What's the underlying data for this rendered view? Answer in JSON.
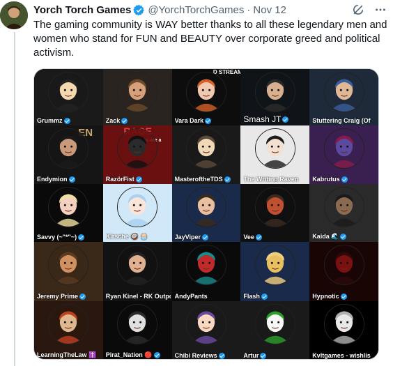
{
  "tweet": {
    "display_name": "Yorch Torch Games",
    "handle": "@YorchTorchGames",
    "separator": "·",
    "time": "Nov 12",
    "text": "The gaming community is WAY better thanks to all these legendary men and women who stand for FUN and BEAUTY over corporate greed and political activism.",
    "icons": {
      "avatar": "user-avatar",
      "verified": "verified-badge-icon",
      "grok": "grok-icon",
      "more": "more-icon"
    }
  },
  "media": {
    "background_texts": [
      "D STREAME",
      "EN",
      "RAGE",
      "ames are a"
    ],
    "cells": [
      {
        "name": "Grummz",
        "verified": true,
        "bg": "#1a1a1a",
        "face": "#f5d7b0",
        "hair": "#222"
      },
      {
        "name": "Zack",
        "verified": true,
        "bg": "#2a2420",
        "face": "#d6a07a",
        "hair": "#6b4a2a"
      },
      {
        "name": "Vara Dark",
        "verified": true,
        "bg": "#0d0d0d",
        "face": "#f0c9b0",
        "hair": "#d4622a"
      },
      {
        "name": "Smash JT",
        "verified": true,
        "bg": "#101418",
        "face": "#d8b090",
        "hair": "#2a2a2a",
        "big": true
      },
      {
        "name": "Stuttering Craig (Of",
        "verified": false,
        "bg": "#1e2a3a",
        "face": "#e0b896",
        "hair": "#3a5e9a"
      },
      {
        "name": "Endymion",
        "verified": true,
        "bg": "#151515",
        "face": "#c89a7a",
        "hair": "#1a1a1a"
      },
      {
        "name": "RazörFist",
        "verified": true,
        "bg": "#6a1010",
        "face": "#2a2a2a",
        "hair": "#111"
      },
      {
        "name": "MasteroftheTDS",
        "verified": true,
        "bg": "#1a1a1a",
        "face": "#f0d8b8",
        "hair": "#5a4a3a"
      },
      {
        "name": "The Writing Raven",
        "verified": false,
        "bg": "#e8e8e8",
        "face": "#f4e0d0",
        "hair": "#1a1a1a"
      },
      {
        "name": "Kabrutus",
        "verified": true,
        "bg": "#3a2050",
        "face": "#5a4aa0",
        "hair": "#8a1a4a"
      },
      {
        "name": "Savvy (~\"*\"~)",
        "verified": true,
        "bg": "#0a0a0a",
        "face": "#f4d0c0",
        "hair": "#f0e0a0"
      },
      {
        "name": "Kirsche 🥥 🧁",
        "verified": false,
        "bg": "#d0e8f8",
        "face": "#fbe4d8",
        "hair": "#a8d0f0"
      },
      {
        "name": "JayViper",
        "verified": true,
        "bg": "#1a2a4a",
        "face": "#e8c0a0",
        "hair": "#3a2a1a"
      },
      {
        "name": "Vee",
        "verified": true,
        "bg": "#101010",
        "face": "#c05030",
        "hair": "#3a2a20"
      },
      {
        "name": "Kaida 🌊",
        "verified": true,
        "bg": "#2a2a2a",
        "face": "#8a6a50",
        "hair": "#1a1a1a"
      },
      {
        "name": "Jeremy Prime",
        "verified": true,
        "bg": "#3a2818",
        "face": "#d09060",
        "hair": "#5a3a20"
      },
      {
        "name": "Ryan Kinel - RK Outpo",
        "verified": false,
        "bg": "#121212",
        "face": "#e0b090",
        "hair": "#222"
      },
      {
        "name": "AndyPants",
        "verified": false,
        "bg": "#0a0a0a",
        "face": "#c02a2a",
        "hair": "#1a8a8a"
      },
      {
        "name": "Flash",
        "verified": true,
        "bg": "#1a2a4a",
        "face": "#e8c060",
        "hair": "#f0d080"
      },
      {
        "name": "Hypnotic",
        "verified": true,
        "bg": "#1a0505",
        "face": "#7a1010",
        "hair": "#2a0a0a"
      },
      {
        "name": "LearningTheLaw ✝️",
        "verified": false,
        "bg": "#2a1810",
        "face": "#e0b890",
        "hair": "#c04020"
      },
      {
        "name": "Pirat_Nation 🔴",
        "verified": true,
        "bg": "#0a0a0a",
        "face": "#e0e0e0",
        "hair": "#2a2a2a"
      },
      {
        "name": "Chibi Reviews",
        "verified": true,
        "bg": "#1a1a1a",
        "face": "#f8d8c0",
        "hair": "#6a4aa0"
      },
      {
        "name": "Artur",
        "verified": true,
        "bg": "#1a1a1a",
        "face": "#f8f8f8",
        "hair": "#2aa02a"
      },
      {
        "name": "Kvltgames - wishlis",
        "verified": false,
        "bg": "#000000",
        "face": "#e8e8e8",
        "hair": "#b0b0b0"
      }
    ]
  }
}
